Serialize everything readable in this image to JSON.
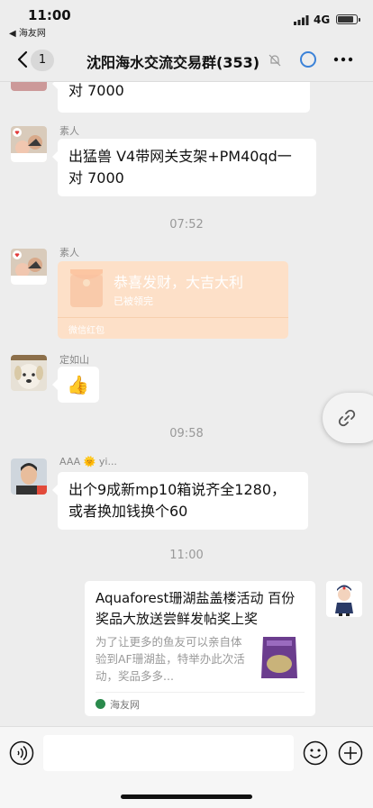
{
  "status": {
    "time": "11:00",
    "back_app": "◀ 海友网",
    "network": "4G",
    "battery": 0.9
  },
  "nav": {
    "unread": "1",
    "title": "沈阳海水交流交易群(353)"
  },
  "messages": {
    "m0": {
      "text": "对 7000"
    },
    "m1": {
      "sender": "素人",
      "text": "出猛兽 V4带网关支架+PM40qd一对 7000"
    },
    "t1": "07:52",
    "m2": {
      "sender": "素人",
      "title": "恭喜发财，大吉大利",
      "status": "已被领完",
      "foot": "微信红包"
    },
    "m3": {
      "sender": "定如山",
      "emoji": "👍"
    },
    "t2": "09:58",
    "m4": {
      "sender": "AAA 🌞 yi...",
      "text": "出个9成新mp10箱说齐全1280，或者换加钱换个60"
    },
    "t3": "11:00",
    "m5": {
      "title": "Aquaforest珊湖盐盖楼活动 百份奖品大放送尝鲜发帖奖上奖",
      "desc": "为了让更多的鱼友可以亲自体验到AF珊湖盐，特举办此次活动，奖品多多...",
      "source": "海友网"
    }
  },
  "colors": {
    "bubble": "#ffffff",
    "chat_bg": "#ededed",
    "redpacket": "#fde0c8",
    "accent": "#3b82d8"
  }
}
